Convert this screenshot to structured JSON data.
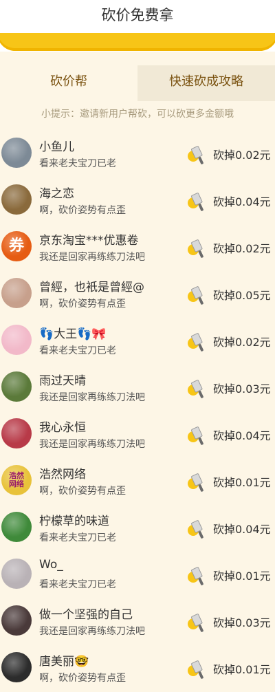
{
  "header": {
    "title": "砍价免费拿"
  },
  "tabs": [
    {
      "label": "砍价帮"
    },
    {
      "label": "快速砍成攻略"
    }
  ],
  "hint": "小提示：邀请新用户帮砍，可以砍更多金额哦",
  "list": [
    {
      "name": "小鱼儿",
      "sub": "看来老夫宝刀已老",
      "amount": "砍掉0.02元",
      "avatar_color": "#7d8a96",
      "avatar_text": ""
    },
    {
      "name": "海之恋",
      "sub": "啊，砍价姿势有点歪",
      "amount": "砍掉0.04元",
      "avatar_color": "#8a6a3c",
      "avatar_text": ""
    },
    {
      "name": "京东淘宝***优惠卷",
      "sub": "我还是回家再练练刀法吧",
      "amount": "砍掉0.02元",
      "avatar_color": "#e65c13",
      "avatar_text": "券"
    },
    {
      "name": "曾經，也衹是曾經@",
      "sub": "啊，砍价姿势有点歪",
      "amount": "砍掉0.05元",
      "avatar_color": "#c7a08c",
      "avatar_text": ""
    },
    {
      "name": "👣大王👣🎀",
      "sub": "看来老夫宝刀已老",
      "amount": "砍掉0.02元",
      "avatar_color": "#f2b9c9",
      "avatar_text": ""
    },
    {
      "name": "雨过天晴",
      "sub": "我还是回家再练练刀法吧",
      "amount": "砍掉0.03元",
      "avatar_color": "#5b7a3a",
      "avatar_text": ""
    },
    {
      "name": "我心永恒",
      "sub": "我还是回家再练练刀法吧",
      "amount": "砍掉0.04元",
      "avatar_color": "#b83a48",
      "avatar_text": ""
    },
    {
      "name": "浩然网络",
      "sub": "啊，砍价姿势有点歪",
      "amount": "砍掉0.01元",
      "avatar_color": "#e8c23a",
      "avatar_text": "浩然\n网络"
    },
    {
      "name": "柠檬草的味道",
      "sub": "看来老夫宝刀已老",
      "amount": "砍掉0.04元",
      "avatar_color": "#3f8a3a",
      "avatar_text": ""
    },
    {
      "name": "Wo_",
      "sub": "看来老夫宝刀已老",
      "amount": "砍掉0.01元",
      "avatar_color": "#b9b2b6",
      "avatar_text": ""
    },
    {
      "name": "做一个坚强的自己",
      "sub": "我还是回家再练练刀法吧",
      "amount": "砍掉0.03元",
      "avatar_color": "#4a3a3a",
      "avatar_text": ""
    },
    {
      "name": "唐美丽🤓",
      "sub": "啊，砍价姿势有点歪",
      "amount": "砍掉0.01元",
      "avatar_color": "#2c2c2c",
      "avatar_text": ""
    }
  ]
}
